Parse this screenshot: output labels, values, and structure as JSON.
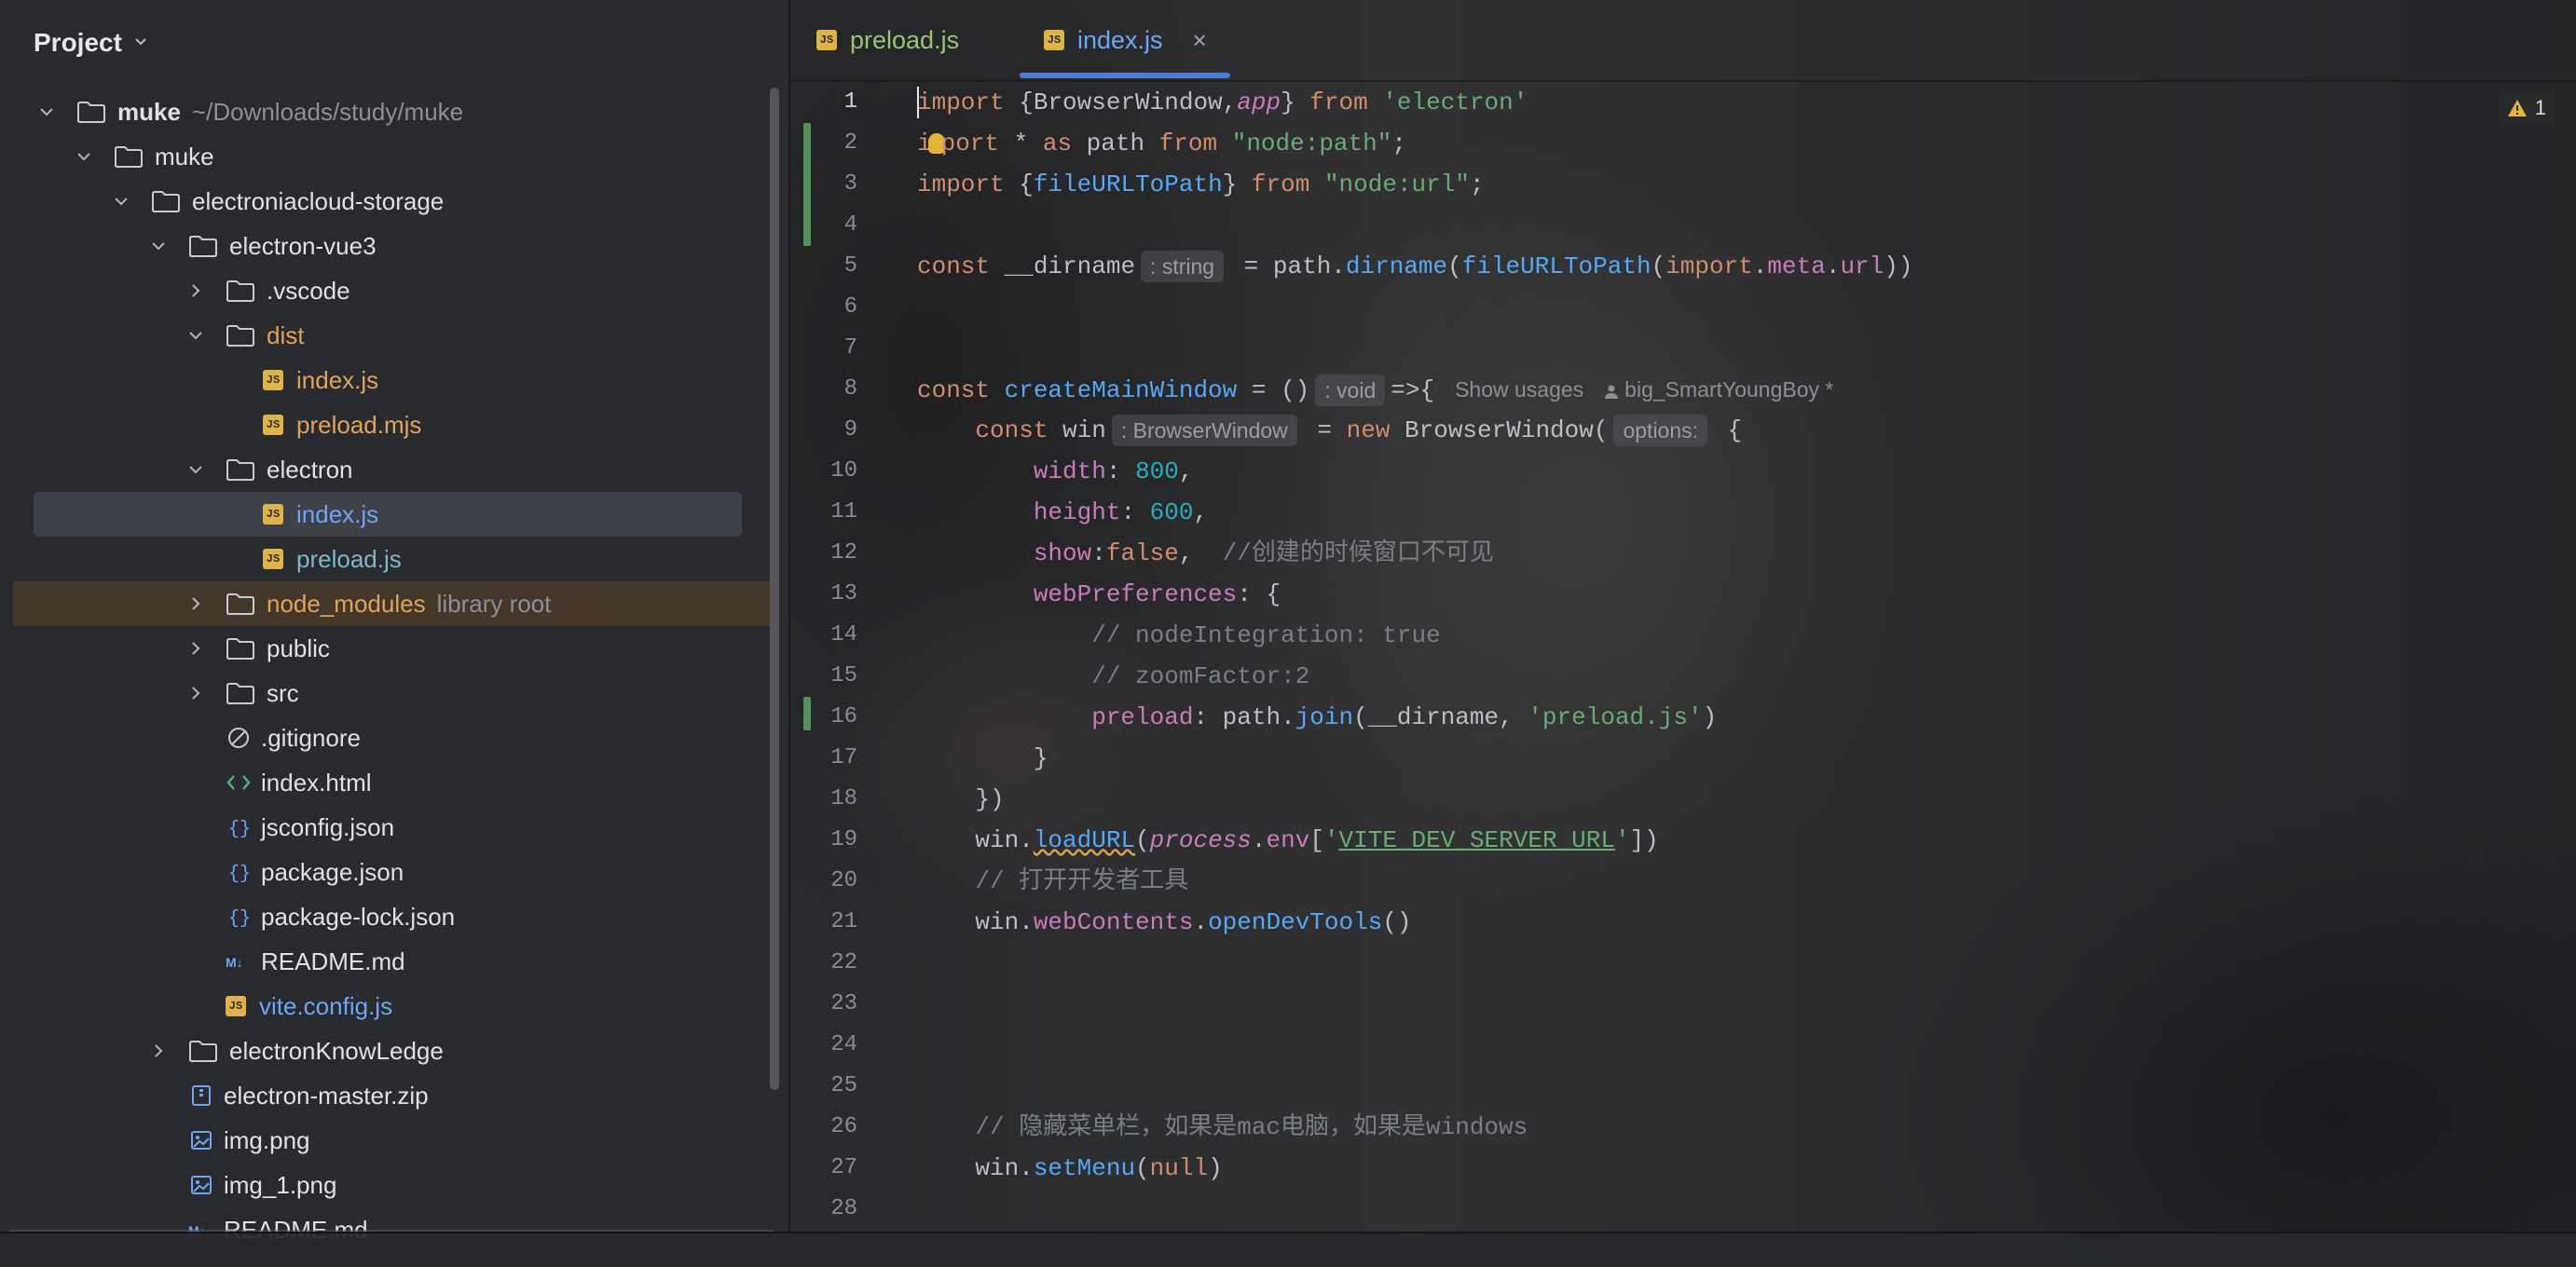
{
  "sidebar": {
    "title": "Project",
    "tree": [
      {
        "label": "muke",
        "hint": "~/Downloads/study/muke",
        "depth": 0,
        "kind": "folder",
        "open": true
      },
      {
        "label": "muke",
        "depth": 1,
        "kind": "folder",
        "open": true
      },
      {
        "label": "electroniacloud-storage",
        "depth": 2,
        "kind": "folder",
        "open": true
      },
      {
        "label": "electron-vue3",
        "depth": 3,
        "kind": "folder",
        "open": true
      },
      {
        "label": ".vscode",
        "depth": 4,
        "kind": "folder",
        "open": false
      },
      {
        "label": "dist",
        "depth": 4,
        "kind": "folder",
        "open": true,
        "color": "orange"
      },
      {
        "label": "index.js",
        "depth": 5,
        "kind": "js",
        "color": "orange"
      },
      {
        "label": "preload.mjs",
        "depth": 5,
        "kind": "js",
        "color": "orange"
      },
      {
        "label": "electron",
        "depth": 4,
        "kind": "folder",
        "open": true
      },
      {
        "label": "index.js",
        "depth": 5,
        "kind": "js",
        "color": "blue",
        "selected": true
      },
      {
        "label": "preload.js",
        "depth": 5,
        "kind": "js",
        "color": "blue-green"
      },
      {
        "label": "node_modules",
        "hint": "library root",
        "depth": 4,
        "kind": "folder",
        "open": false,
        "color": "orange",
        "lib": true
      },
      {
        "label": "public",
        "depth": 4,
        "kind": "folder",
        "open": false
      },
      {
        "label": "src",
        "depth": 4,
        "kind": "folder",
        "open": false
      },
      {
        "label": ".gitignore",
        "depth": 4,
        "kind": "ignore"
      },
      {
        "label": "index.html",
        "depth": 4,
        "kind": "html"
      },
      {
        "label": "jsconfig.json",
        "depth": 4,
        "kind": "json"
      },
      {
        "label": "package.json",
        "depth": 4,
        "kind": "json"
      },
      {
        "label": "package-lock.json",
        "depth": 4,
        "kind": "json"
      },
      {
        "label": "README.md",
        "depth": 4,
        "kind": "md"
      },
      {
        "label": "vite.config.js",
        "depth": 4,
        "kind": "js",
        "color": "blue"
      },
      {
        "label": "electronKnowLedge",
        "depth": 3,
        "kind": "folder",
        "open": false
      },
      {
        "label": "electron-master.zip",
        "depth": 3,
        "kind": "zip"
      },
      {
        "label": "img.png",
        "depth": 3,
        "kind": "img"
      },
      {
        "label": "img_1.png",
        "depth": 3,
        "kind": "img"
      },
      {
        "label": "README.md",
        "depth": 3,
        "kind": "md"
      }
    ]
  },
  "editor": {
    "tabs": [
      {
        "label": "preload.js",
        "active": false
      },
      {
        "label": "index.js",
        "active": true
      }
    ],
    "close_symbol": "×",
    "warnings": {
      "icon": "warning-icon",
      "count": "1"
    },
    "line_numbers": [
      "1",
      "2",
      "3",
      "4",
      "5",
      "6",
      "7",
      "8",
      "9",
      "10",
      "11",
      "12",
      "13",
      "14",
      "15",
      "16",
      "17",
      "18",
      "19",
      "20",
      "21",
      "22",
      "23",
      "24",
      "25",
      "26",
      "27",
      "28"
    ],
    "code": {
      "l1_a": "import",
      "l1_b": " {BrowserWindow,",
      "l1_c": "app",
      "l1_d": "} ",
      "l1_e": "from",
      "l1_f": " ",
      "l1_g": "'electron'",
      "l2_a": "i",
      "l2_b": "port",
      "l2_c": " * ",
      "l2_d": "as",
      "l2_e": " path ",
      "l2_f": "from",
      "l2_g": " ",
      "l2_h": "\"node:path\"",
      "l2_i": ";",
      "l3_a": "import",
      "l3_b": " {",
      "l3_c": "fileURLToPath",
      "l3_d": "} ",
      "l3_e": "from",
      "l3_f": " ",
      "l3_g": "\"node:url\"",
      "l3_h": ";",
      "l5_a": "const",
      "l5_b": " __dirname",
      "l5_hint": ": string",
      "l5_c": " = path.",
      "l5_d": "dirname",
      "l5_e": "(",
      "l5_f": "fileURLToPath",
      "l5_g": "(",
      "l5_h": "import",
      "l5_i": ".",
      "l5_j": "meta",
      "l5_k": ".",
      "l5_l": "url",
      "l5_m": "))",
      "l8_a": "const",
      "l8_b": " ",
      "l8_c": "createMainWindow",
      "l8_d": " = ()",
      "l8_hint": ": void",
      "l8_e": "=>{",
      "l8_usages": "Show usages",
      "l8_author": "big_SmartYoungBoy *",
      "l9_a": "    const",
      "l9_b": " win",
      "l9_hint": ": BrowserWindow",
      "l9_c": " = ",
      "l9_d": "new",
      "l9_e": " BrowserWindow(",
      "l9_hint2": "options:",
      "l9_f": " {",
      "l10_a": "        width",
      "l10_b": ": ",
      "l10_c": "800",
      "l10_d": ",",
      "l11_a": "        height",
      "l11_b": ": ",
      "l11_c": "600",
      "l11_d": ",",
      "l12_a": "        show",
      "l12_b": ":",
      "l12_c": "false",
      "l12_d": ",  ",
      "l12_e": "//创建的时候窗口不可见",
      "l13_a": "        webPreferences",
      "l13_b": ": {",
      "l14": "            // nodeIntegration: true",
      "l15": "            // zoomFactor:2",
      "l16_a": "            preload",
      "l16_b": ": path.",
      "l16_c": "join",
      "l16_d": "(__dirname, ",
      "l16_e": "'preload.js'",
      "l16_f": ")",
      "l17": "        }",
      "l18": "    })",
      "l19_a": "    win.",
      "l19_b": "loadURL",
      "l19_c": "(",
      "l19_d": "process",
      "l19_e": ".",
      "l19_f": "env",
      "l19_g": "[",
      "l19_h": "'",
      "l19_i": "VITE_DEV_SERVER_URL",
      "l19_j": "'",
      "l19_k": "])",
      "l20": "    // 打开开发者工具",
      "l21_a": "    win.",
      "l21_b": "webContents",
      "l21_c": ".",
      "l21_d": "openDevTools",
      "l21_e": "()",
      "l26": "    // 隐藏菜单栏，如果是mac电脑，如果是windows",
      "l27_a": "    win.",
      "l27_b": "setMenu",
      "l27_c": "(",
      "l27_d": "null",
      "l27_e": ")"
    }
  }
}
